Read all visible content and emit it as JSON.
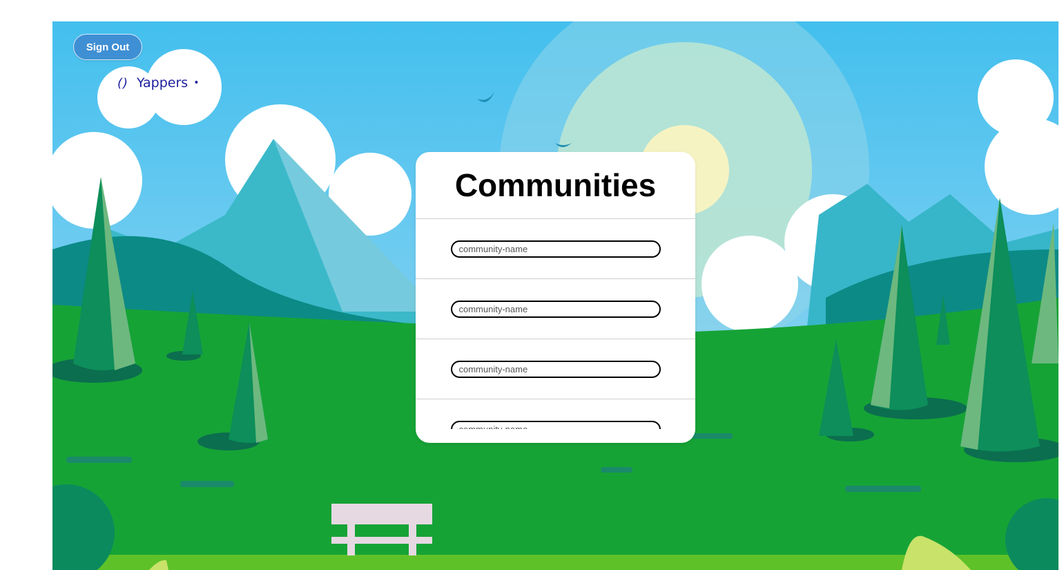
{
  "header": {
    "sign_out_label": "Sign Out",
    "logo_mark": "()",
    "logo_text": "Yappers",
    "logo_dot": "•"
  },
  "panel": {
    "title": "Communities",
    "rows": [
      {
        "placeholder": "community-name"
      },
      {
        "placeholder": "community-name"
      },
      {
        "placeholder": "community-name"
      },
      {
        "placeholder": "community-name"
      }
    ]
  },
  "colors": {
    "sky": "#4fc3ec",
    "grass": "#1aa13a",
    "button": "#3f8fd4",
    "logo": "#1c1f9e"
  },
  "icons": {
    "background": "park-landscape-illustration"
  }
}
